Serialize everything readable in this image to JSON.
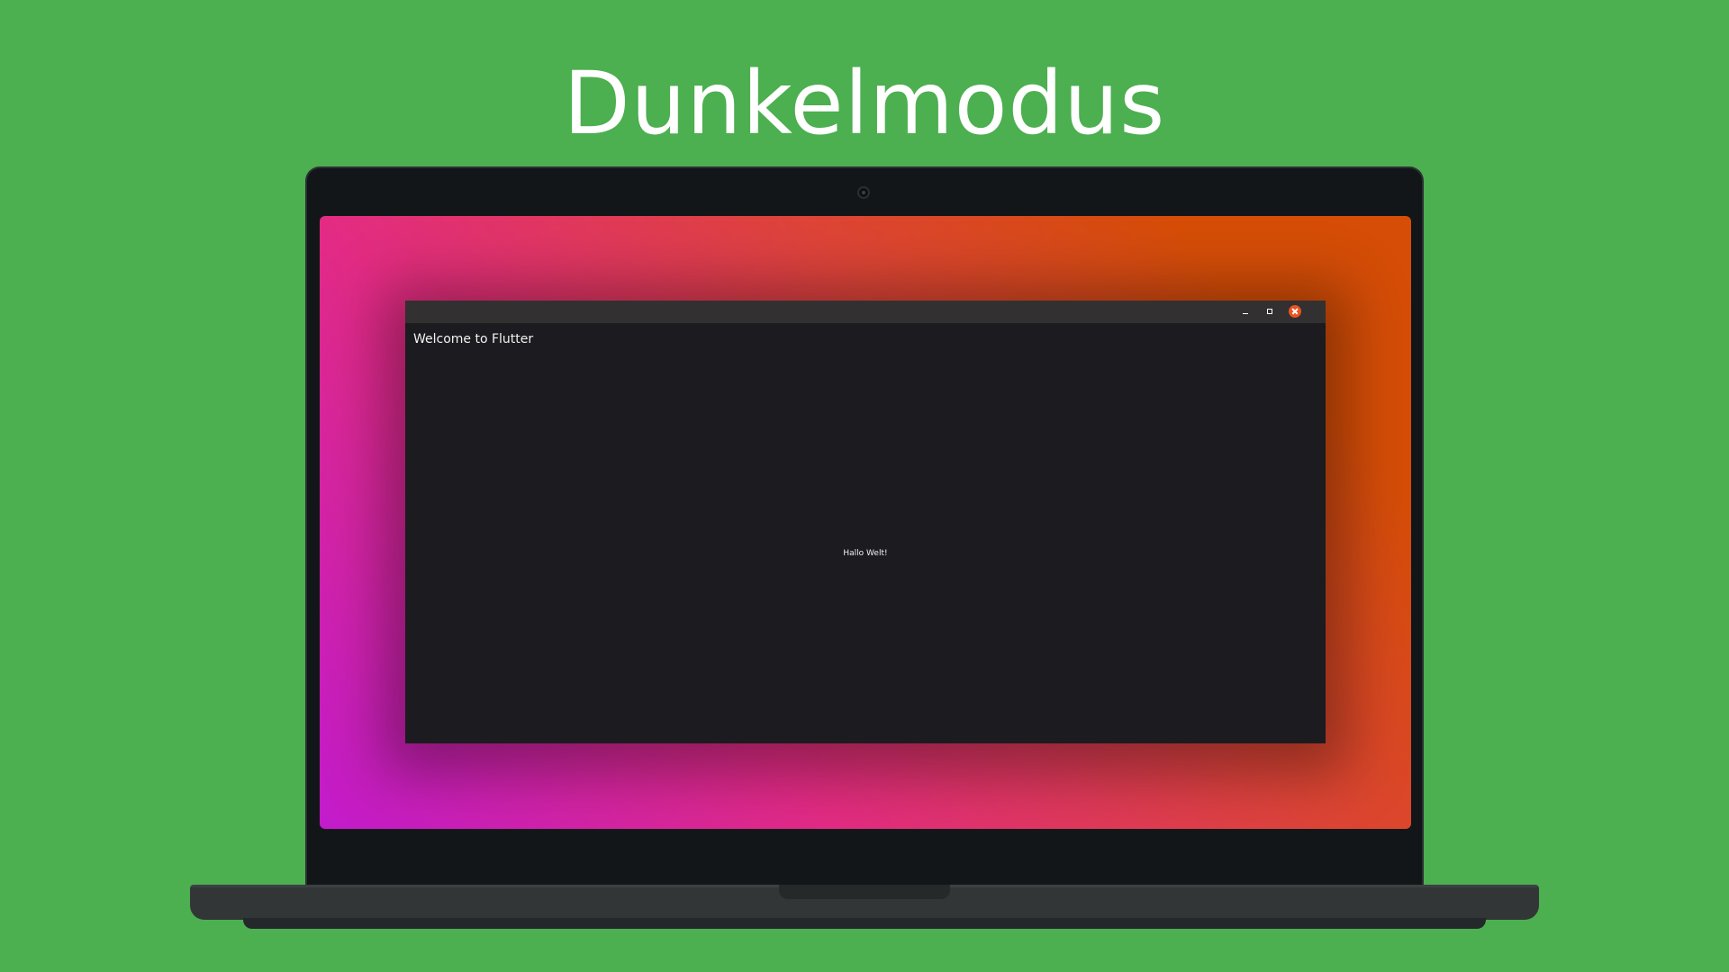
{
  "headline": "Dunkelmodus",
  "app": {
    "title": "Welcome to Flutter",
    "body_text": "Hallo Welt!",
    "window_buttons": [
      "minimize",
      "maximize",
      "close"
    ]
  },
  "colors": {
    "background": "#4caf50",
    "window_bg": "#1c1b1f",
    "titlebar_bg": "#323030",
    "close_button": "#e95420",
    "wallpaper_gradient": [
      "#c21bcc",
      "#e32b84",
      "#de4438",
      "#d54d07"
    ]
  },
  "icons": {
    "minimize": "minimize-icon",
    "maximize": "maximize-icon",
    "close": "close-icon",
    "camera": "camera-icon"
  }
}
